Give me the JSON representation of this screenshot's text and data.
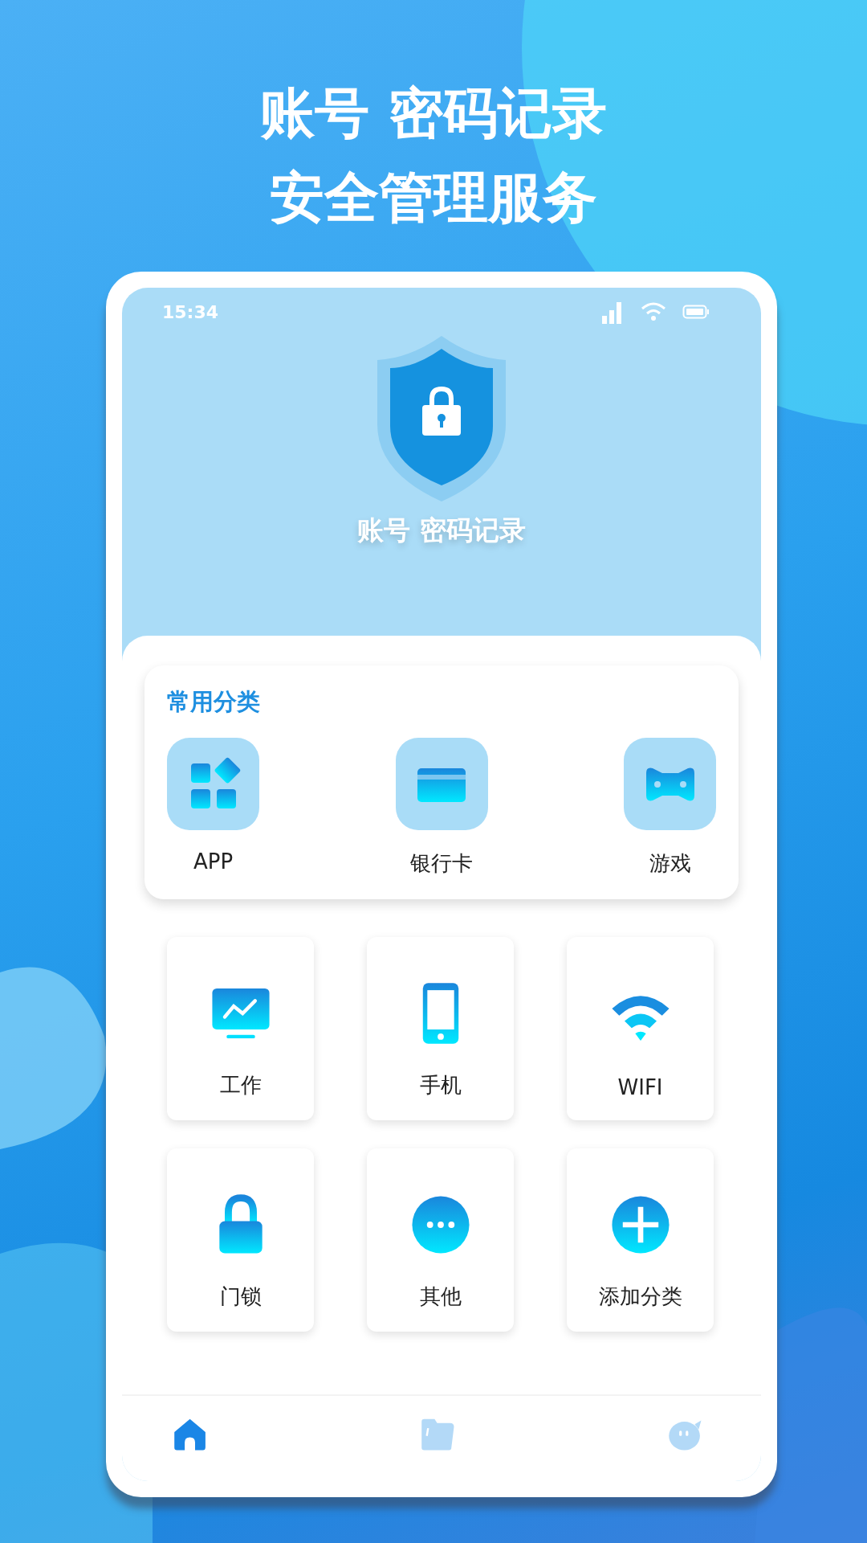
{
  "headline": [
    "账号 密码记录",
    "安全管理服务"
  ],
  "status_bar": {
    "time": "15:34"
  },
  "header": {
    "title": "账号 密码记录"
  },
  "common_categories": {
    "title": "常用分类",
    "items": [
      {
        "label": "APP",
        "kind": "apps"
      },
      {
        "label": "银行卡",
        "kind": "card"
      },
      {
        "label": "游戏",
        "kind": "gamepad"
      }
    ]
  },
  "categories": [
    {
      "label": "工作",
      "kind": "monitor"
    },
    {
      "label": "手机",
      "kind": "phone"
    },
    {
      "label": "WIFI",
      "kind": "wifi"
    },
    {
      "label": "门锁",
      "kind": "lock"
    },
    {
      "label": "其他",
      "kind": "more"
    },
    {
      "label": "添加分类",
      "kind": "add"
    }
  ],
  "tab_bar": [
    {
      "kind": "home",
      "selected": true
    },
    {
      "kind": "folder",
      "selected": false
    },
    {
      "kind": "chat",
      "selected": false
    }
  ]
}
